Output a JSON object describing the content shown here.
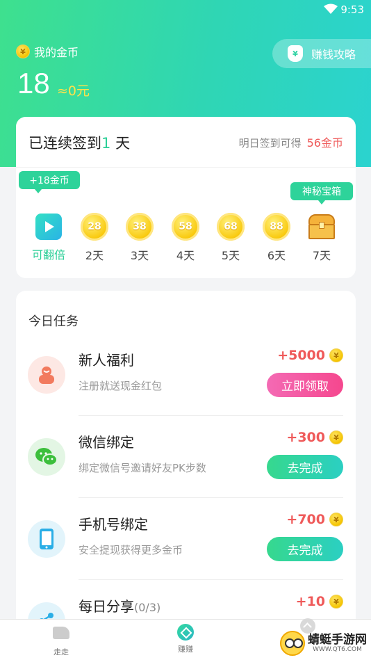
{
  "status": {
    "time": "9:53"
  },
  "header": {
    "my_coins_label": "我的金币",
    "coin_count": "18",
    "coin_value": "≈0元",
    "strategy_label": "赚钱攻略",
    "coin_glyph": "¥"
  },
  "signin": {
    "title_prefix": "已连续签到",
    "days": "1",
    "title_suffix": "天",
    "tomorrow_label": "明日签到可得",
    "tomorrow_gain": "56金币",
    "bonus_tag": "+18金币",
    "box_tag": "神秘宝箱",
    "items": [
      {
        "value": "",
        "label": "可翻倍",
        "icon": "play-icon"
      },
      {
        "value": "28",
        "label": "2天",
        "icon": "coin-icon"
      },
      {
        "value": "38",
        "label": "3天",
        "icon": "coin-icon"
      },
      {
        "value": "58",
        "label": "4天",
        "icon": "coin-icon"
      },
      {
        "value": "68",
        "label": "5天",
        "icon": "coin-icon"
      },
      {
        "value": "88",
        "label": "6天",
        "icon": "coin-icon"
      },
      {
        "value": "",
        "label": "7天",
        "icon": "treasure-chest-icon"
      }
    ]
  },
  "tasks": {
    "title": "今日任务",
    "items": [
      {
        "name": "新人福利",
        "name_extra": "",
        "desc": "注册就送现金红包",
        "reward": "+5000",
        "button": "立即领取",
        "icon": "user-gift-icon",
        "icon_bg": "#fde8e4",
        "button_color": "pink"
      },
      {
        "name": "微信绑定",
        "name_extra": "",
        "desc": "绑定微信号邀请好友PK步数",
        "reward": "+300",
        "button": "去完成",
        "icon": "wechat-icon",
        "icon_bg": "#e3f6e4",
        "button_color": "green"
      },
      {
        "name": "手机号绑定",
        "name_extra": "",
        "desc": "安全提现获得更多金币",
        "reward": "+700",
        "button": "去完成",
        "icon": "phone-icon",
        "icon_bg": "#e2f4fb",
        "button_color": "green"
      },
      {
        "name": "每日分享",
        "name_extra": "(0/3)",
        "desc": "",
        "reward": "+10",
        "button": "",
        "icon": "share-icon",
        "icon_bg": "#e2f4fb",
        "button_color": "green"
      }
    ]
  },
  "nav": {
    "walk_label": "走走",
    "earn_label": "赚赚"
  },
  "watermark": {
    "text": "蜻蜓手游网",
    "url": "WWW.QT6.COM"
  }
}
